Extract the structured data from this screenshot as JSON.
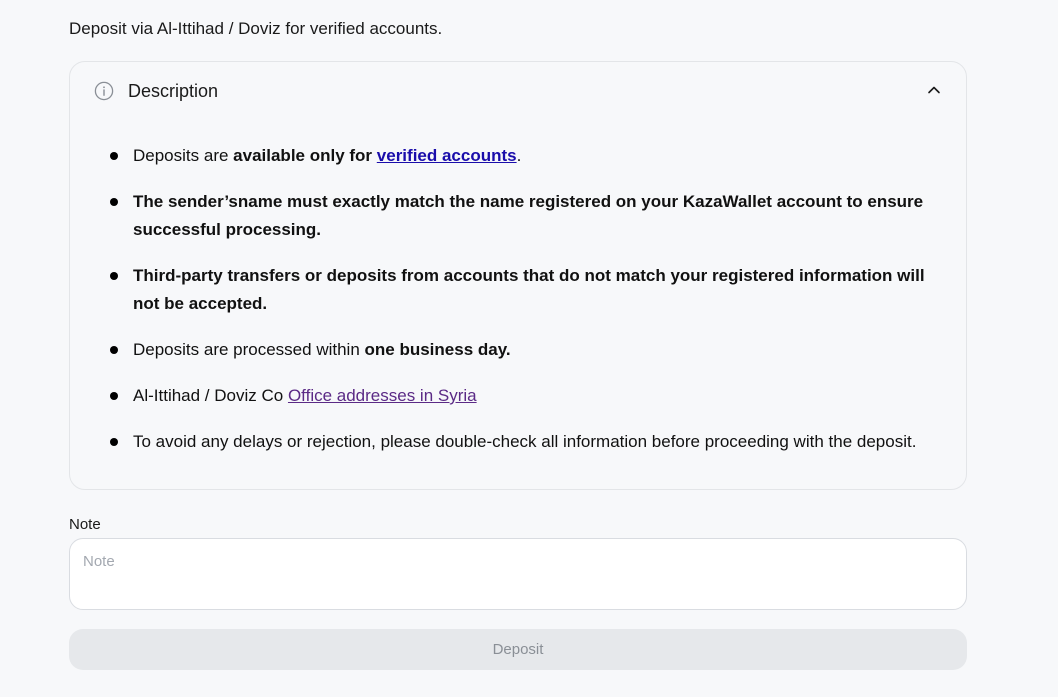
{
  "intro_text": "Deposit via Al-Ittihad / Doviz for verified accounts.",
  "description": {
    "title": "Description",
    "items": [
      {
        "pre": "Deposits are ",
        "bold": "available only for ",
        "link": "verified accounts",
        "post": "."
      },
      {
        "bold": "The sender’sname must exactly match the name registered on your KazaWallet account to ensure successful processing."
      },
      {
        "bold": "Third-party transfers or deposits from accounts that do not match your registered information will not be accepted."
      },
      {
        "pre": "Deposits are processed within ",
        "bold": "one business day."
      },
      {
        "pre": "Al-Ittihad / Doviz Co ",
        "link": "Office addresses in Syria"
      },
      {
        "pre": "To avoid any delays or rejection, please double-check all information before proceeding with the deposit."
      }
    ]
  },
  "note": {
    "label": "Note",
    "placeholder": "Note",
    "value": ""
  },
  "deposit_button": {
    "label": "Deposit"
  },
  "colors": {
    "background": "#f7f8fa",
    "link_verified": "#1a0dab",
    "link_office": "#5b2a86",
    "button_bg": "#e6e8eb",
    "button_text": "#8a8f96"
  },
  "icons": {
    "header_icon": "info-icon",
    "toggle_icon": "chevron-up-icon"
  }
}
